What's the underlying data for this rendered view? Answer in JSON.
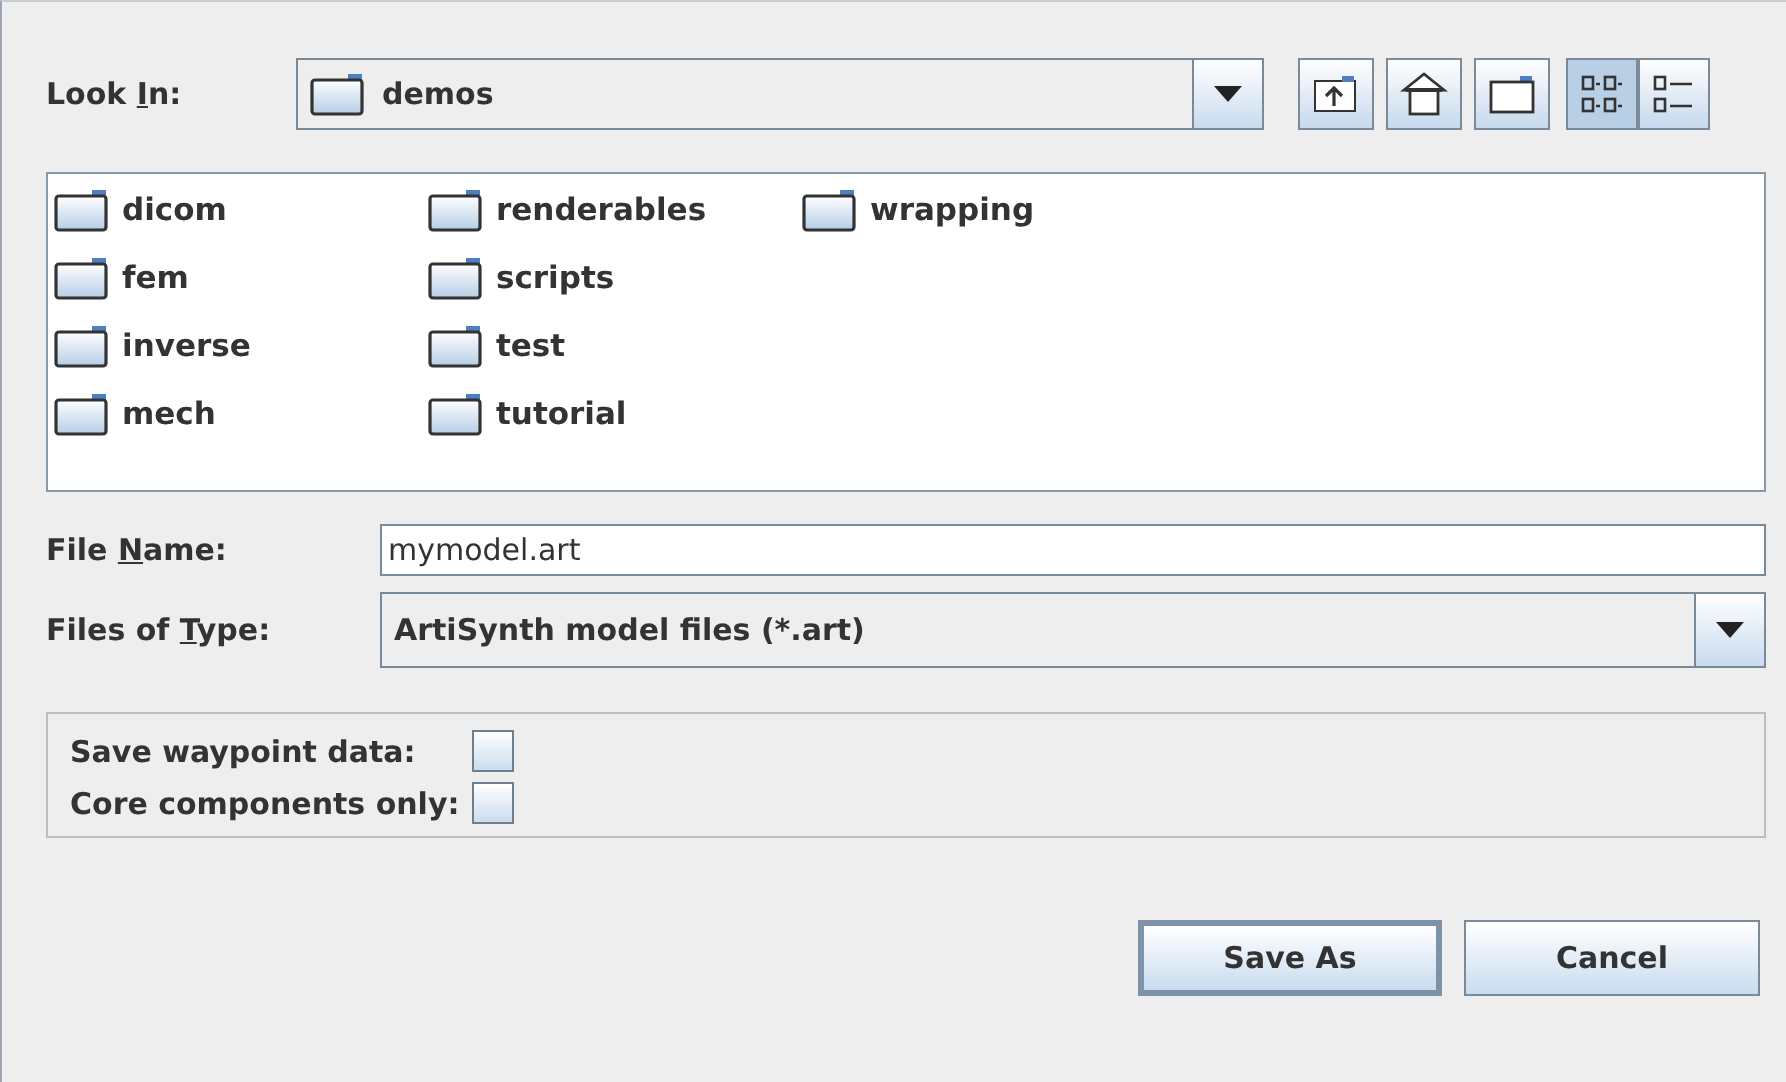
{
  "look_in": {
    "label": {
      "before": "Look ",
      "key": "I",
      "after": "n:"
    },
    "value": "demos"
  },
  "toolbar": [
    {
      "kind": "up",
      "selected": false
    },
    {
      "kind": "home",
      "selected": false
    },
    {
      "kind": "new_folder",
      "selected": false
    },
    {
      "kind": "list",
      "selected": true
    },
    {
      "kind": "details",
      "selected": false
    }
  ],
  "files": [
    {
      "name": "dicom"
    },
    {
      "name": "fem"
    },
    {
      "name": "inverse"
    },
    {
      "name": "mech"
    },
    {
      "name": "renderables"
    },
    {
      "name": "scripts"
    },
    {
      "name": "test"
    },
    {
      "name": "tutorial"
    },
    {
      "name": "wrapping"
    }
  ],
  "file_name": {
    "label": {
      "before": "File ",
      "key": "N",
      "after": "ame:"
    },
    "value": "mymodel.art"
  },
  "file_type": {
    "label": {
      "before": "Files of ",
      "key": "T",
      "after": "ype:"
    },
    "value": "ArtiSynth model files (*.art)"
  },
  "options": [
    {
      "label": "Save waypoint data:",
      "checked": false
    },
    {
      "label": "Core components only:",
      "checked": false
    }
  ],
  "buttons": [
    {
      "label": "Save As",
      "default": true
    },
    {
      "label": "Cancel",
      "default": false
    }
  ]
}
